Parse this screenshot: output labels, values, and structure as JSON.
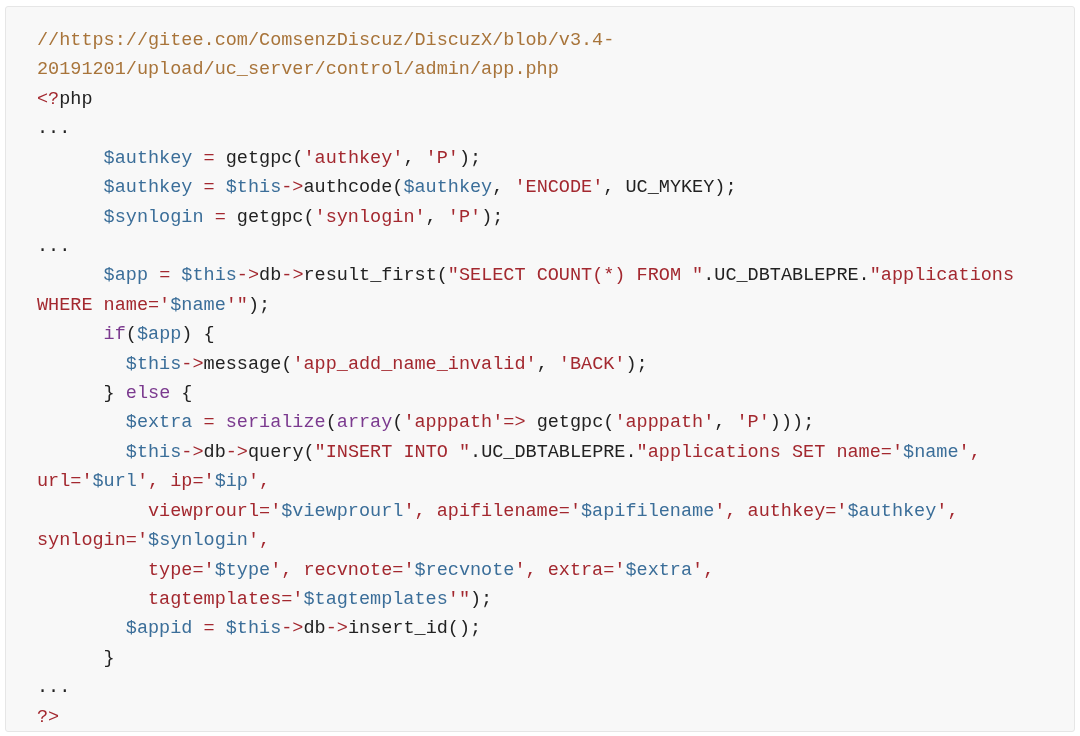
{
  "code_block": {
    "lines": [
      {
        "tokens": [
          {
            "kind": "comment",
            "text": "//https://gitee.com/ComsenzDiscuz/DiscuzX/blob/v3.4-"
          }
        ]
      },
      {
        "tokens": [
          {
            "kind": "comment",
            "text": "20191201/upload/uc_server/control/admin/app.php"
          }
        ]
      },
      {
        "tokens": [
          {
            "kind": "op",
            "text": "<?"
          },
          {
            "kind": "plain",
            "text": "php"
          }
        ]
      },
      {
        "tokens": [
          {
            "kind": "plain",
            "text": "..."
          }
        ]
      },
      {
        "tokens": [
          {
            "kind": "var",
            "text": "      $authkey"
          },
          {
            "kind": "op",
            "text": " = "
          },
          {
            "kind": "plain",
            "text": "getgpc("
          },
          {
            "kind": "str",
            "text": "'authkey'"
          },
          {
            "kind": "plain",
            "text": ", "
          },
          {
            "kind": "str",
            "text": "'P'"
          },
          {
            "kind": "plain",
            "text": ");"
          }
        ]
      },
      {
        "tokens": [
          {
            "kind": "var",
            "text": "      $authkey"
          },
          {
            "kind": "op",
            "text": " = "
          },
          {
            "kind": "var",
            "text": "$this"
          },
          {
            "kind": "op",
            "text": "->"
          },
          {
            "kind": "plain",
            "text": "authcode("
          },
          {
            "kind": "var",
            "text": "$authkey"
          },
          {
            "kind": "plain",
            "text": ", "
          },
          {
            "kind": "str",
            "text": "'ENCODE'"
          },
          {
            "kind": "plain",
            "text": ", UC_MYKEY);"
          }
        ]
      },
      {
        "tokens": [
          {
            "kind": "var",
            "text": "      $synlogin"
          },
          {
            "kind": "op",
            "text": " = "
          },
          {
            "kind": "plain",
            "text": "getgpc("
          },
          {
            "kind": "str",
            "text": "'synlogin'"
          },
          {
            "kind": "plain",
            "text": ", "
          },
          {
            "kind": "str",
            "text": "'P'"
          },
          {
            "kind": "plain",
            "text": ");"
          }
        ]
      },
      {
        "tokens": [
          {
            "kind": "plain",
            "text": "..."
          }
        ]
      },
      {
        "tokens": [
          {
            "kind": "var",
            "text": "      $app"
          },
          {
            "kind": "op",
            "text": " = "
          },
          {
            "kind": "var",
            "text": "$this"
          },
          {
            "kind": "op",
            "text": "->"
          },
          {
            "kind": "plain",
            "text": "db"
          },
          {
            "kind": "op",
            "text": "->"
          },
          {
            "kind": "plain",
            "text": "result_first("
          },
          {
            "kind": "str",
            "text": "\"SELECT COUNT(*) FROM \""
          },
          {
            "kind": "plain",
            "text": ".UC_DBTABLEPRE."
          },
          {
            "kind": "str",
            "text": "\"applications"
          }
        ]
      },
      {
        "tokens": [
          {
            "kind": "str",
            "text": "WHERE name='"
          },
          {
            "kind": "var",
            "text": "$name"
          },
          {
            "kind": "str",
            "text": "'\""
          },
          {
            "kind": "plain",
            "text": ");"
          }
        ]
      },
      {
        "tokens": [
          {
            "kind": "kw",
            "text": "      if"
          },
          {
            "kind": "plain",
            "text": "("
          },
          {
            "kind": "var",
            "text": "$app"
          },
          {
            "kind": "plain",
            "text": ") {"
          }
        ]
      },
      {
        "tokens": [
          {
            "kind": "var",
            "text": "        $this"
          },
          {
            "kind": "op",
            "text": "->"
          },
          {
            "kind": "plain",
            "text": "message("
          },
          {
            "kind": "str",
            "text": "'app_add_name_invalid'"
          },
          {
            "kind": "plain",
            "text": ", "
          },
          {
            "kind": "str",
            "text": "'BACK'"
          },
          {
            "kind": "plain",
            "text": ");"
          }
        ]
      },
      {
        "tokens": [
          {
            "kind": "plain",
            "text": "      } "
          },
          {
            "kind": "kw",
            "text": "else"
          },
          {
            "kind": "plain",
            "text": " {"
          }
        ]
      },
      {
        "tokens": [
          {
            "kind": "var",
            "text": "        $extra"
          },
          {
            "kind": "op",
            "text": " = "
          },
          {
            "kind": "kw",
            "text": "serialize"
          },
          {
            "kind": "plain",
            "text": "("
          },
          {
            "kind": "kw",
            "text": "array"
          },
          {
            "kind": "plain",
            "text": "("
          },
          {
            "kind": "str",
            "text": "'apppath'"
          },
          {
            "kind": "op",
            "text": "=>"
          },
          {
            "kind": "plain",
            "text": " getgpc("
          },
          {
            "kind": "str",
            "text": "'apppath'"
          },
          {
            "kind": "plain",
            "text": ", "
          },
          {
            "kind": "str",
            "text": "'P'"
          },
          {
            "kind": "plain",
            "text": ")));"
          }
        ]
      },
      {
        "tokens": [
          {
            "kind": "var",
            "text": "        $this"
          },
          {
            "kind": "op",
            "text": "->"
          },
          {
            "kind": "plain",
            "text": "db"
          },
          {
            "kind": "op",
            "text": "->"
          },
          {
            "kind": "plain",
            "text": "query("
          },
          {
            "kind": "str",
            "text": "\"INSERT INTO \""
          },
          {
            "kind": "plain",
            "text": ".UC_DBTABLEPRE."
          },
          {
            "kind": "str",
            "text": "\"applications SET name='"
          },
          {
            "kind": "var",
            "text": "$name"
          },
          {
            "kind": "str",
            "text": "',"
          }
        ]
      },
      {
        "tokens": [
          {
            "kind": "str",
            "text": "url='"
          },
          {
            "kind": "var",
            "text": "$url"
          },
          {
            "kind": "str",
            "text": "', ip='"
          },
          {
            "kind": "var",
            "text": "$ip"
          },
          {
            "kind": "str",
            "text": "',"
          }
        ]
      },
      {
        "tokens": [
          {
            "kind": "str",
            "text": "          viewprourl='"
          },
          {
            "kind": "var",
            "text": "$viewprourl"
          },
          {
            "kind": "str",
            "text": "', apifilename='"
          },
          {
            "kind": "var",
            "text": "$apifilename"
          },
          {
            "kind": "str",
            "text": "', authkey='"
          },
          {
            "kind": "var",
            "text": "$authkey"
          },
          {
            "kind": "str",
            "text": "',"
          }
        ]
      },
      {
        "tokens": [
          {
            "kind": "str",
            "text": "synlogin='"
          },
          {
            "kind": "var",
            "text": "$synlogin"
          },
          {
            "kind": "str",
            "text": "',"
          }
        ]
      },
      {
        "tokens": [
          {
            "kind": "str",
            "text": "          type='"
          },
          {
            "kind": "var",
            "text": "$type"
          },
          {
            "kind": "str",
            "text": "', recvnote='"
          },
          {
            "kind": "var",
            "text": "$recvnote"
          },
          {
            "kind": "str",
            "text": "', extra='"
          },
          {
            "kind": "var",
            "text": "$extra"
          },
          {
            "kind": "str",
            "text": "',"
          }
        ]
      },
      {
        "tokens": [
          {
            "kind": "str",
            "text": "          tagtemplates='"
          },
          {
            "kind": "var",
            "text": "$tagtemplates"
          },
          {
            "kind": "str",
            "text": "'\""
          },
          {
            "kind": "plain",
            "text": ");"
          }
        ]
      },
      {
        "tokens": [
          {
            "kind": "var",
            "text": "        $appid"
          },
          {
            "kind": "op",
            "text": " = "
          },
          {
            "kind": "var",
            "text": "$this"
          },
          {
            "kind": "op",
            "text": "->"
          },
          {
            "kind": "plain",
            "text": "db"
          },
          {
            "kind": "op",
            "text": "->"
          },
          {
            "kind": "plain",
            "text": "insert_id();"
          }
        ]
      },
      {
        "tokens": [
          {
            "kind": "plain",
            "text": "      }"
          }
        ]
      },
      {
        "tokens": [
          {
            "kind": "plain",
            "text": "..."
          }
        ]
      },
      {
        "tokens": [
          {
            "kind": "op",
            "text": "?>"
          }
        ]
      }
    ]
  }
}
